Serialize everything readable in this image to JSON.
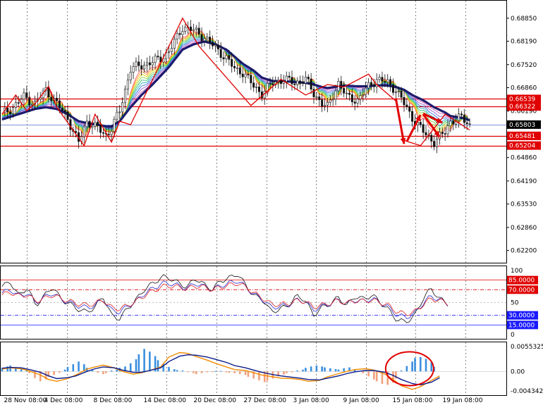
{
  "chart_data": [
    {
      "type": "candlestick",
      "panel": "main",
      "ylim": [
        0.6185,
        0.6935
      ],
      "yticks": [
        "0.68850",
        "0.68190",
        "0.67520",
        "0.66860",
        "0.66190",
        "0.64860",
        "0.64190",
        "0.63530",
        "0.62860",
        "0.62200"
      ],
      "yticks_values": [
        0.6885,
        0.6819,
        0.6752,
        0.6686,
        0.6619,
        0.6486,
        0.6419,
        0.6353,
        0.6286,
        0.622
      ],
      "current_price": {
        "value": 0.65803,
        "label": "0.65803"
      },
      "horizontal_levels": [
        {
          "value": 0.66539,
          "label": "0.66539"
        },
        {
          "value": 0.66322,
          "label": "0.66322"
        },
        {
          "value": 0.65481,
          "label": "0.65481"
        },
        {
          "value": 0.65204,
          "label": "0.65204"
        }
      ],
      "price_path_x": [
        0,
        4,
        8,
        12,
        16,
        20,
        24,
        26,
        28,
        31,
        35,
        38,
        40,
        43,
        47,
        51,
        55,
        58,
        61,
        64,
        66,
        70,
        74,
        78,
        82,
        85,
        88,
        92,
        95,
        99,
        103,
        107,
        111,
        114,
        117,
        119,
        123,
        126,
        130,
        134,
        137,
        141,
        144,
        147,
        150,
        154,
        158,
        162,
        164,
        168,
        171
      ],
      "price_path_y": [
        0.661,
        0.663,
        0.666,
        0.664,
        0.668,
        0.664,
        0.66,
        0.656,
        0.653,
        0.659,
        0.657,
        0.655,
        0.657,
        0.662,
        0.674,
        0.675,
        0.676,
        0.677,
        0.679,
        0.683,
        0.686,
        0.685,
        0.683,
        0.68,
        0.677,
        0.674,
        0.673,
        0.669,
        0.667,
        0.67,
        0.671,
        0.67,
        0.671,
        0.667,
        0.664,
        0.663,
        0.67,
        0.666,
        0.665,
        0.669,
        0.671,
        0.67,
        0.668,
        0.664,
        0.66,
        0.656,
        0.653,
        0.656,
        0.659,
        0.66,
        0.658
      ],
      "ma_path_y": [
        0.6595,
        0.6605,
        0.6615,
        0.6625,
        0.663,
        0.6625,
        0.661,
        0.66,
        0.659,
        0.6585,
        0.658,
        0.6575,
        0.6575,
        0.659,
        0.663,
        0.6665,
        0.6695,
        0.672,
        0.6745,
        0.6775,
        0.6795,
        0.681,
        0.6818,
        0.681,
        0.6795,
        0.6775,
        0.6755,
        0.6735,
        0.6715,
        0.6705,
        0.6705,
        0.6702,
        0.67,
        0.6695,
        0.6688,
        0.6685,
        0.669,
        0.6692,
        0.669,
        0.669,
        0.6693,
        0.6692,
        0.6688,
        0.668,
        0.6665,
        0.665,
        0.663,
        0.6615,
        0.6605,
        0.66,
        0.6593
      ],
      "zigzag_x": [
        0,
        5,
        9,
        12,
        17,
        20,
        30,
        34,
        40,
        43,
        47,
        66,
        72,
        91,
        102,
        111,
        119,
        125,
        134,
        137,
        144,
        147,
        153,
        162,
        167,
        171
      ],
      "zigzag_y": [
        0.661,
        0.6665,
        0.662,
        0.664,
        0.669,
        0.663,
        0.652,
        0.661,
        0.653,
        0.659,
        0.658,
        0.6885,
        0.6805,
        0.6635,
        0.671,
        0.6665,
        0.6695,
        0.6688,
        0.6725,
        0.6695,
        0.6648,
        0.6535,
        0.652,
        0.661,
        0.6585,
        0.6565
      ]
    },
    {
      "type": "line",
      "panel": "oscillator",
      "ylim": [
        0,
        100
      ],
      "yticks": [
        "100",
        "85.0000",
        "70.0000",
        "50",
        "30.0000",
        "15.0000",
        "0"
      ],
      "yticks_values": [
        100,
        85,
        70,
        50,
        30,
        15,
        0
      ],
      "levels": [
        {
          "value": 85,
          "label": "85.0000",
          "color": "#e00000"
        },
        {
          "value": 70,
          "label": "70.0000",
          "color": "#e00000"
        },
        {
          "value": 30,
          "label": "30.0000",
          "color": "#1a1aff"
        },
        {
          "value": 15,
          "label": "15.0000",
          "color": "#1a1aff"
        }
      ],
      "series": [
        {
          "color": "#111111",
          "values": [
            75,
            82,
            60,
            74,
            45,
            60,
            75,
            55,
            48,
            40,
            35,
            42,
            60,
            30,
            25,
            42,
            55,
            72,
            80,
            90,
            88,
            80,
            74,
            88,
            78,
            70,
            84,
            88,
            95,
            76,
            60,
            55,
            35,
            40,
            45,
            60,
            55,
            30,
            42,
            48,
            58,
            45,
            60,
            55,
            62,
            50,
            38,
            22,
            20,
            28,
            55,
            72,
            56,
            48
          ]
        },
        {
          "color": "#2a2ad0",
          "values": [
            65,
            70,
            60,
            65,
            50,
            58,
            65,
            55,
            50,
            45,
            42,
            45,
            55,
            38,
            35,
            45,
            52,
            65,
            72,
            80,
            80,
            76,
            72,
            80,
            75,
            70,
            76,
            80,
            84,
            74,
            62,
            55,
            42,
            44,
            46,
            54,
            52,
            38,
            44,
            48,
            54,
            48,
            54,
            52,
            56,
            50,
            42,
            30,
            27,
            32,
            48,
            60,
            54,
            48
          ]
        },
        {
          "color": "#e02020",
          "values": [
            62,
            66,
            60,
            62,
            52,
            56,
            62,
            56,
            52,
            48,
            46,
            48,
            54,
            42,
            40,
            46,
            52,
            62,
            68,
            75,
            76,
            74,
            71,
            76,
            74,
            70,
            74,
            77,
            80,
            74,
            64,
            57,
            47,
            47,
            48,
            53,
            52,
            43,
            46,
            49,
            53,
            49,
            53,
            52,
            54,
            50,
            45,
            35,
            32,
            35,
            46,
            56,
            53,
            49
          ]
        }
      ]
    },
    {
      "type": "bar",
      "panel": "macd",
      "ylim": [
        -0.0043426,
        0.0055325
      ],
      "yticks": [
        "0.0055325",
        "0.00",
        "-0.0043426"
      ],
      "yticks_values": [
        0.0055325,
        0.0,
        -0.0043426
      ],
      "histogram": [
        0.0008,
        0.0011,
        0.0013,
        0.0009,
        0.0005,
        0.0003,
        -0.0004,
        -0.0015,
        -0.0022,
        -0.0018,
        -0.0012,
        -0.0008,
        -0.0003,
        0.0004,
        0.001,
        0.0016,
        0.0022,
        0.0016,
        0.0008,
        0.0003,
        -0.0003,
        -0.0006,
        -0.0004,
        0.0002,
        0.0004,
        0.0008,
        0.0011,
        0.0018,
        0.0027,
        0.0038,
        0.005,
        0.0044,
        0.0034,
        0.0025,
        0.0017,
        0.001,
        0.0005,
        0.0003,
        0.0002,
        -0.0001,
        -0.0004,
        -0.0006,
        -0.0004,
        -0.0002,
        -0.0001,
        0.0001,
        0.0001,
        -0.0002,
        -0.0003,
        -0.0004,
        -0.0006,
        -0.0008,
        -0.0012,
        -0.0016,
        -0.002,
        -0.0024,
        -0.0021,
        -0.0016,
        -0.0011,
        -0.0007,
        -0.0004,
        -0.0002,
        0.0002,
        0.0004,
        0.0008,
        0.0011,
        0.0013,
        0.0011,
        0.0009,
        0.0007,
        0.0005,
        0.0004,
        0.0007,
        0.0009,
        0.0004,
        0.0001,
        -0.0004,
        -0.0011,
        -0.0018,
        -0.0022,
        -0.0028,
        -0.003,
        -0.0025,
        -0.0016,
        0.0002,
        0.0012,
        0.0022,
        0.003,
        0.0032,
        0.0028,
        0.002,
        0.001
      ],
      "signal_line": [
        0.0005,
        0.0008,
        0.0006,
        0.0001,
        -0.0008,
        -0.0018,
        -0.0022,
        -0.0016,
        -0.0008,
        0.0005,
        0.001,
        0.0014,
        0.0008,
        0.0,
        -0.0006,
        -0.0003,
        0.0002,
        0.001,
        0.0032,
        0.0042,
        0.004,
        0.0033,
        0.0025,
        0.0018,
        0.001,
        0.0004,
        0.0002,
        -0.0003,
        -0.0008,
        -0.0012,
        -0.0015,
        -0.0016,
        -0.0018,
        -0.0022,
        -0.002,
        -0.0012,
        -0.0005,
        0.0,
        0.0004,
        0.0006,
        0.0003,
        -0.0006,
        -0.0018,
        -0.0032,
        -0.004,
        -0.0034,
        -0.002,
        -0.001
      ],
      "macd_line": [
        0.0007,
        0.0009,
        0.0008,
        0.0004,
        -0.0002,
        -0.001,
        -0.0016,
        -0.0014,
        -0.001,
        0.0,
        0.0006,
        0.001,
        0.0008,
        0.0003,
        -0.0002,
        -0.0002,
        0.0002,
        0.0008,
        0.0022,
        0.0034,
        0.0037,
        0.0036,
        0.0032,
        0.0027,
        0.002,
        0.0013,
        0.0008,
        0.0003,
        -0.0002,
        -0.0007,
        -0.001,
        -0.0013,
        -0.0015,
        -0.0018,
        -0.0019,
        -0.0015,
        -0.001,
        -0.0005,
        -0.0001,
        0.0002,
        0.0002,
        -0.0002,
        -0.0009,
        -0.0018,
        -0.0027,
        -0.003,
        -0.0024,
        -0.0014
      ]
    }
  ],
  "x_axis_labels": [
    "28 Nov 08:00",
    "4 Dec 08:00",
    "8 Dec 08:00",
    "14 Dec 08:00",
    "20 Dec 08:00",
    "27 Dec 08:00",
    "3 Jan 08:00",
    "9 Jan 08:00",
    "15 Jan 08:00",
    "19 Jan 08:00"
  ],
  "colors": {
    "ma_thick": "#1c1c6e",
    "zigzag": "#e00000",
    "level_line": "#e00000",
    "current_line": "#5a6fd0",
    "macd_pos": "#3a8fe0",
    "macd_neg": "#f2a07a",
    "signal": "#f28c00",
    "macd_line": "#0a1a8a",
    "highlight_circle": "#e00000"
  }
}
